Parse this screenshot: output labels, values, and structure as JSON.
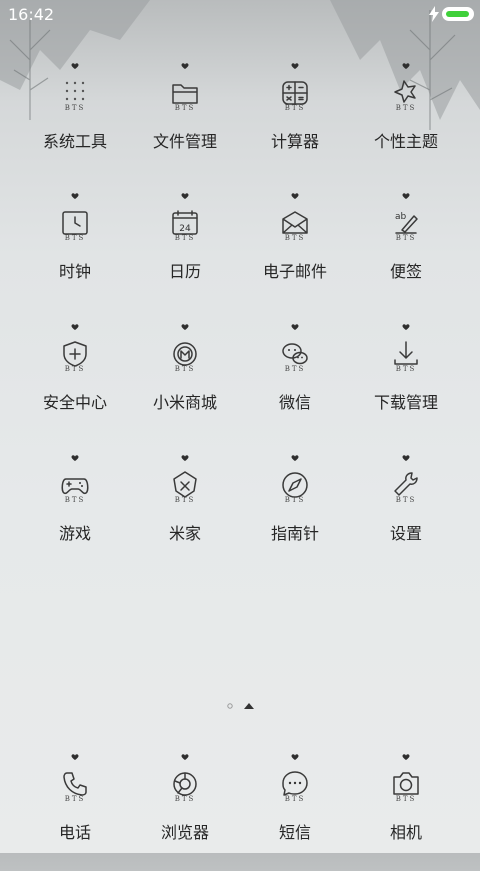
{
  "status_bar": {
    "time": "16:42",
    "battery_color": "#3fd03a",
    "battery_level": 0.9
  },
  "icon_brand_text": "BTS",
  "apps": [
    {
      "label": "系统工具",
      "icon": "folder-grid-icon"
    },
    {
      "label": "文件管理",
      "icon": "folder-icon"
    },
    {
      "label": "计算器",
      "icon": "calculator-icon"
    },
    {
      "label": "个性主题",
      "icon": "theme-brush-icon"
    },
    {
      "label": "时钟",
      "icon": "clock-icon"
    },
    {
      "label": "日历",
      "icon": "calendar-icon"
    },
    {
      "label": "电子邮件",
      "icon": "email-icon"
    },
    {
      "label": "便签",
      "icon": "notes-icon"
    },
    {
      "label": "安全中心",
      "icon": "shield-icon"
    },
    {
      "label": "小米商城",
      "icon": "mi-store-icon"
    },
    {
      "label": "微信",
      "icon": "wechat-icon"
    },
    {
      "label": "下载管理",
      "icon": "download-icon"
    },
    {
      "label": "游戏",
      "icon": "gamepad-icon"
    },
    {
      "label": "米家",
      "icon": "mijia-icon"
    },
    {
      "label": "指南针",
      "icon": "compass-icon"
    },
    {
      "label": "设置",
      "icon": "wrench-icon"
    }
  ],
  "calendar_day": "24",
  "dock": [
    {
      "label": "电话",
      "icon": "phone-icon"
    },
    {
      "label": "浏览器",
      "icon": "browser-icon"
    },
    {
      "label": "短信",
      "icon": "message-icon"
    },
    {
      "label": "相机",
      "icon": "camera-icon"
    }
  ]
}
